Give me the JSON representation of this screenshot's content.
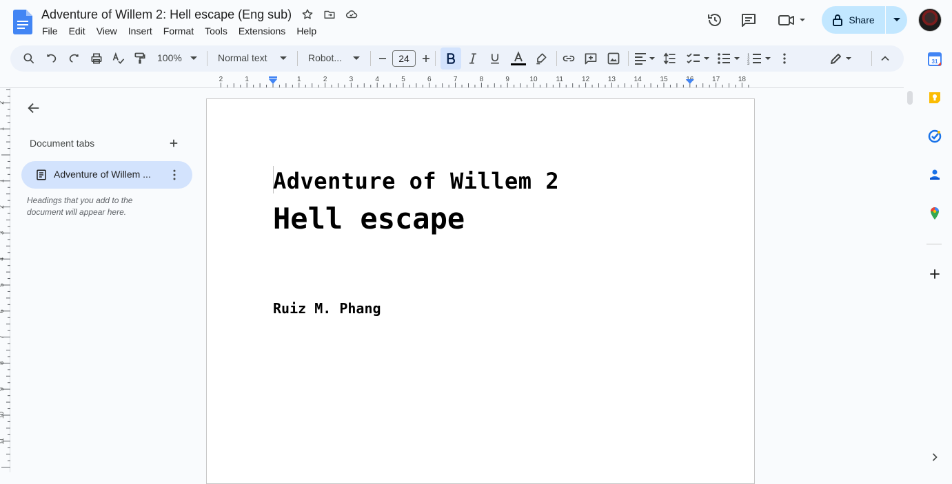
{
  "app": {
    "doc_title": "Adventure of Willem 2: Hell escape (Eng sub)",
    "menu": [
      "File",
      "Edit",
      "View",
      "Insert",
      "Format",
      "Tools",
      "Extensions",
      "Help"
    ],
    "share_label": "Share"
  },
  "toolbar": {
    "zoom": "100%",
    "style": "Normal text",
    "font": "Robot...",
    "font_size": "24"
  },
  "sidebar": {
    "tabs_title": "Document tabs",
    "tab_label": "Adventure of Willem ...",
    "hint": "Headings that you add to the document will appear here."
  },
  "ruler": {
    "h_labels": [
      "2",
      "1",
      "1",
      "2",
      "3",
      "4",
      "5",
      "6",
      "7",
      "8",
      "9",
      "10",
      "11",
      "12",
      "13",
      "14",
      "15",
      "16",
      "17",
      "18"
    ],
    "v_labels": [
      "2",
      "1",
      "1",
      "2",
      "3",
      "4",
      "5",
      "6",
      "7",
      "8",
      "9",
      "10",
      "11"
    ]
  },
  "document": {
    "line1": "Adventure of Willem 2",
    "line2": "Hell escape",
    "author": "Ruiz M. Phang"
  },
  "colors": {
    "accent": "#c2e7ff",
    "toolbar_bg": "#edf2fa",
    "active_tab": "#d3e3fd",
    "docs_blue": "#4285f4"
  },
  "icons": {
    "header": [
      "docs-logo-icon",
      "star-icon",
      "move-folder-icon",
      "cloud-saved-icon",
      "history-icon",
      "comment-icon",
      "video-call-icon",
      "lock-icon"
    ],
    "right_panel": [
      "calendar-icon",
      "keep-icon",
      "tasks-icon",
      "contacts-icon",
      "maps-icon",
      "add-icon",
      "expand-icon"
    ]
  }
}
